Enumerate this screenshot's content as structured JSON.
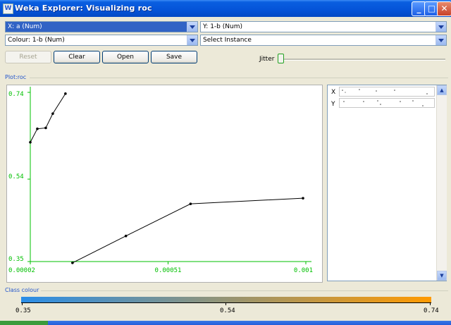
{
  "window": {
    "title": "Weka Explorer: Visualizing roc",
    "app_icon_glyph": "W",
    "minimize_glyph": "_",
    "maximize_glyph": "□",
    "close_glyph": "✕"
  },
  "controls": {
    "x_axis": "X: a (Num)",
    "y_axis": "Y: 1-b (Num)",
    "colour": "Colour: 1-b (Num)",
    "select_instance": "Select Instance",
    "reset_label": "Reset",
    "clear_label": "Clear",
    "open_label": "Open",
    "save_label": "Save",
    "jitter_label": "Jitter",
    "jitter_level": 0
  },
  "plot": {
    "label": "Plot:roc",
    "x_ticks": [
      "0.00002",
      "0.00051",
      "0.001"
    ],
    "y_ticks": [
      "0.74",
      "0.54",
      "0.35"
    ],
    "axis_color": "#00c000",
    "tick_label_color": "#00c000",
    "point_color": "#000000"
  },
  "chart_data": {
    "type": "line",
    "x_range": [
      2e-05,
      0.001
    ],
    "y_range": [
      0.35,
      0.74
    ],
    "x_tick_values": [
      2e-05,
      0.00051,
      0.001
    ],
    "y_tick_values": [
      0.74,
      0.54,
      0.35
    ],
    "series": [
      {
        "points": [
          [
            2e-05,
            0.625
          ],
          [
            4.5e-05,
            0.656
          ],
          [
            7.5e-05,
            0.658
          ],
          [
            0.0001,
            0.691
          ],
          [
            0.000145,
            0.737
          ]
        ]
      },
      {
        "points": [
          [
            0.00017,
            0.347
          ],
          [
            0.00036,
            0.409
          ],
          [
            0.00059,
            0.483
          ],
          [
            0.00099,
            0.496
          ]
        ]
      }
    ]
  },
  "side_panel": {
    "x_label": "X",
    "y_label": "Y",
    "label_color": "#cc2222",
    "scroll_up_glyph": "▲",
    "scroll_down_glyph": "▼"
  },
  "class_colour": {
    "label": "Class colour",
    "ticks": [
      "0.35",
      "0.54",
      "0.74"
    ],
    "gradient_start": "#2a8ee8",
    "gradient_end": "#ff9a00"
  }
}
